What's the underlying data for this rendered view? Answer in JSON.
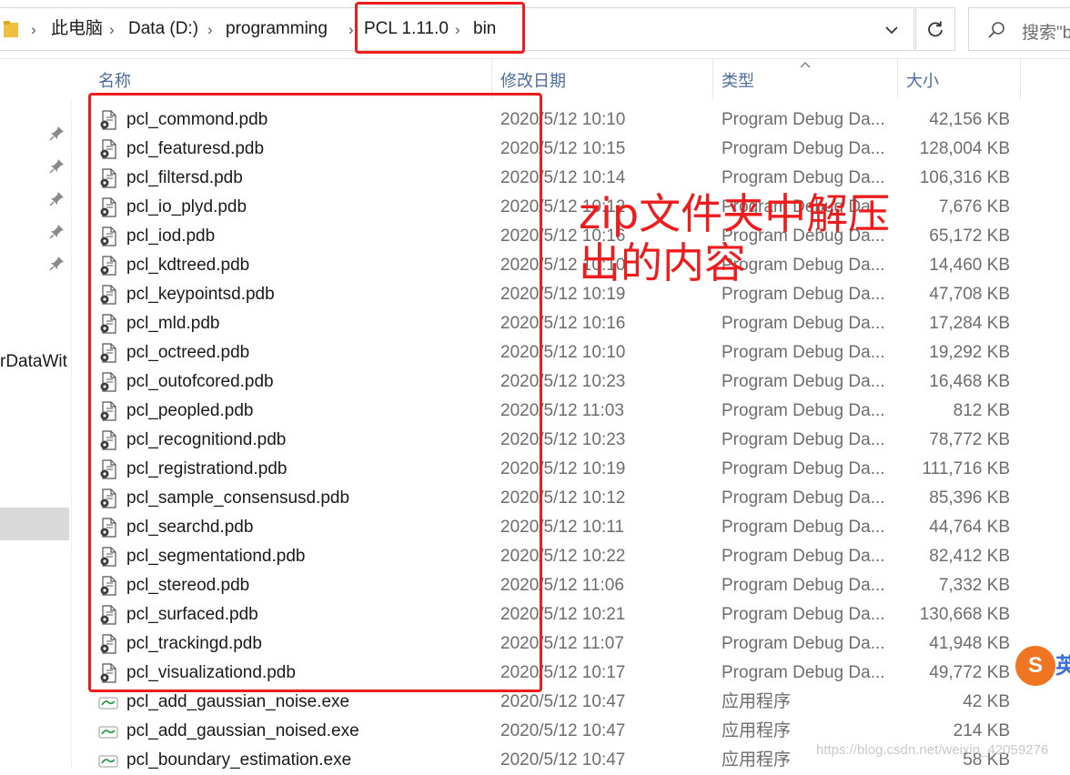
{
  "breadcrumb": {
    "items": [
      "此电脑",
      "Data (D:)",
      "programming",
      "PCL 1.11.0",
      "bin"
    ]
  },
  "search": {
    "placeholder": "搜索\"bi"
  },
  "nav": {
    "partial_label": "rDataWit"
  },
  "columns": {
    "name": "名称",
    "date": "修改日期",
    "type": "类型",
    "size": "大小"
  },
  "files": [
    {
      "name": "pcl_commond.pdb",
      "date": "2020/5/12 10:10",
      "type": "Program Debug Da...",
      "size": "42,156 KB",
      "icon": "pdb-icon"
    },
    {
      "name": "pcl_featuresd.pdb",
      "date": "2020/5/12 10:15",
      "type": "Program Debug Da...",
      "size": "128,004 KB",
      "icon": "pdb-icon"
    },
    {
      "name": "pcl_filtersd.pdb",
      "date": "2020/5/12 10:14",
      "type": "Program Debug Da...",
      "size": "106,316 KB",
      "icon": "pdb-icon"
    },
    {
      "name": "pcl_io_plyd.pdb",
      "date": "2020/5/12 10:12",
      "type": "Program Debug Da...",
      "size": "7,676 KB",
      "icon": "pdb-icon"
    },
    {
      "name": "pcl_iod.pdb",
      "date": "2020/5/12 10:16",
      "type": "Program Debug Da...",
      "size": "65,172 KB",
      "icon": "pdb-icon"
    },
    {
      "name": "pcl_kdtreed.pdb",
      "date": "2020/5/12 10:10",
      "type": "Program Debug Da...",
      "size": "14,460 KB",
      "icon": "pdb-icon"
    },
    {
      "name": "pcl_keypointsd.pdb",
      "date": "2020/5/12 10:19",
      "type": "Program Debug Da...",
      "size": "47,708 KB",
      "icon": "pdb-icon"
    },
    {
      "name": "pcl_mld.pdb",
      "date": "2020/5/12 10:16",
      "type": "Program Debug Da...",
      "size": "17,284 KB",
      "icon": "pdb-icon"
    },
    {
      "name": "pcl_octreed.pdb",
      "date": "2020/5/12 10:10",
      "type": "Program Debug Da...",
      "size": "19,292 KB",
      "icon": "pdb-icon"
    },
    {
      "name": "pcl_outofcored.pdb",
      "date": "2020/5/12 10:23",
      "type": "Program Debug Da...",
      "size": "16,468 KB",
      "icon": "pdb-icon"
    },
    {
      "name": "pcl_peopled.pdb",
      "date": "2020/5/12 11:03",
      "type": "Program Debug Da...",
      "size": "812 KB",
      "icon": "pdb-icon"
    },
    {
      "name": "pcl_recognitiond.pdb",
      "date": "2020/5/12 10:23",
      "type": "Program Debug Da...",
      "size": "78,772 KB",
      "icon": "pdb-icon"
    },
    {
      "name": "pcl_registrationd.pdb",
      "date": "2020/5/12 10:19",
      "type": "Program Debug Da...",
      "size": "111,716 KB",
      "icon": "pdb-icon"
    },
    {
      "name": "pcl_sample_consensusd.pdb",
      "date": "2020/5/12 10:12",
      "type": "Program Debug Da...",
      "size": "85,396 KB",
      "icon": "pdb-icon"
    },
    {
      "name": "pcl_searchd.pdb",
      "date": "2020/5/12 10:11",
      "type": "Program Debug Da...",
      "size": "44,764 KB",
      "icon": "pdb-icon"
    },
    {
      "name": "pcl_segmentationd.pdb",
      "date": "2020/5/12 10:22",
      "type": "Program Debug Da...",
      "size": "82,412 KB",
      "icon": "pdb-icon"
    },
    {
      "name": "pcl_stereod.pdb",
      "date": "2020/5/12 11:06",
      "type": "Program Debug Da...",
      "size": "7,332 KB",
      "icon": "pdb-icon"
    },
    {
      "name": "pcl_surfaced.pdb",
      "date": "2020/5/12 10:21",
      "type": "Program Debug Da...",
      "size": "130,668 KB",
      "icon": "pdb-icon"
    },
    {
      "name": "pcl_trackingd.pdb",
      "date": "2020/5/12 11:07",
      "type": "Program Debug Da...",
      "size": "41,948 KB",
      "icon": "pdb-icon"
    },
    {
      "name": "pcl_visualizationd.pdb",
      "date": "2020/5/12 10:17",
      "type": "Program Debug Da...",
      "size": "49,772 KB",
      "icon": "pdb-icon"
    },
    {
      "name": "pcl_add_gaussian_noise.exe",
      "date": "2020/5/12 10:47",
      "type": "应用程序",
      "size": "42 KB",
      "icon": "exe-icon"
    },
    {
      "name": "pcl_add_gaussian_noised.exe",
      "date": "2020/5/12 10:47",
      "type": "应用程序",
      "size": "214 KB",
      "icon": "exe-icon"
    },
    {
      "name": "pcl_boundary_estimation.exe",
      "date": "2020/5/12 10:47",
      "type": "应用程序",
      "size": "58 KB",
      "icon": "exe-icon"
    }
  ],
  "annotation": {
    "text": "zip文件夹中解压出的内容"
  },
  "ime_glyph": "S",
  "ime_side_glyph": "英",
  "watermark": "https://blog.csdn.net/weixin_42059276",
  "colors": {
    "annotation_red": "#ee1c1c",
    "header_text": "#4d6d9a",
    "ime_orange": "#f07522"
  }
}
